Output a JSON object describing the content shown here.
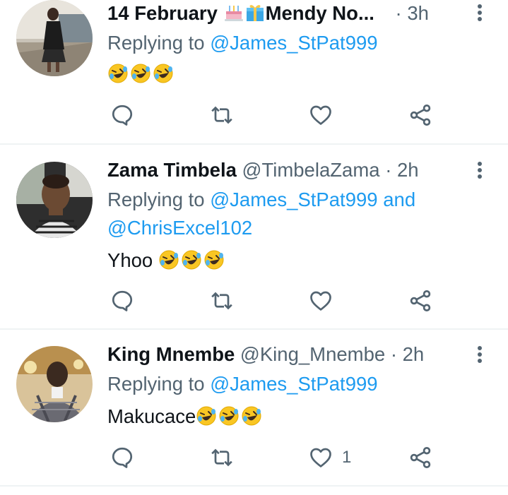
{
  "tweets": [
    {
      "name": "14 February ",
      "name_suffix": "Mendy No...",
      "handle": "",
      "dot": "·",
      "time": "3h",
      "replying_prefix": "Replying to",
      "replying_to_1": "@James_StPat999",
      "replying_and": "",
      "replying_to_2": "",
      "text": "",
      "emoji": [
        "rolling-on-floor-laughing",
        "rolling-on-floor-laughing",
        "rolling-on-floor-laughing"
      ],
      "like_count": ""
    },
    {
      "name": "Zama Timbela",
      "handle": "@TimbelaZama",
      "dot": "·",
      "time": "2h",
      "replying_prefix": "Replying to",
      "replying_to_1": "@James_StPat999",
      "replying_and": "and",
      "replying_to_2": "@ChrisExcel102",
      "text": "Yhoo",
      "emoji": [
        "rolling-on-floor-laughing",
        "rolling-on-floor-laughing",
        "rolling-on-floor-laughing"
      ],
      "like_count": ""
    },
    {
      "name": "King Mnembe",
      "handle": "@King_Mnembe",
      "dot": "·",
      "time": "2h",
      "replying_prefix": "Replying to",
      "replying_to_1": "@James_StPat999",
      "replying_and": "",
      "replying_to_2": "",
      "text": "Makucace",
      "emoji": [
        "rolling-on-floor-laughing",
        "rolling-on-floor-laughing",
        "rolling-on-floor-laughing"
      ],
      "like_count": "1"
    }
  ],
  "colors": {
    "link": "#1d9bf0",
    "secondary_text": "#536471",
    "divider": "#eff3f4"
  },
  "icons": [
    "reply-icon",
    "retweet-icon",
    "like-icon",
    "share-icon",
    "more-options-icon",
    "birthday-cake-icon",
    "gift-icon"
  ]
}
